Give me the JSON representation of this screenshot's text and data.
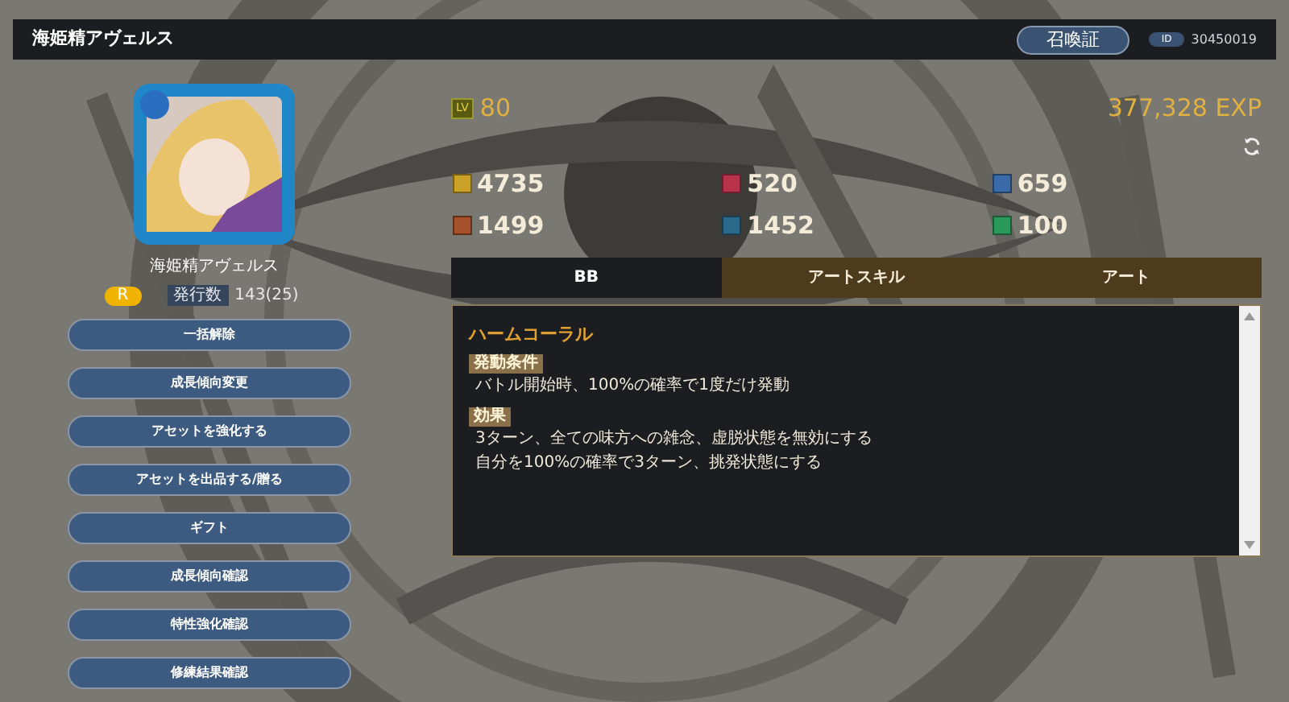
{
  "header": {
    "title": "海姫精アヴェルス",
    "card_button": "召喚証",
    "id_badge": "ID",
    "id_value": "30450019"
  },
  "unit": {
    "kind": "picture",
    "name": "海姫精アヴェルス",
    "rarity": "R",
    "issued_label": "発行数",
    "issued_value": "143(25)"
  },
  "actions": [
    "一括解除",
    "成長傾向変更",
    "アセットを強化する",
    "アセットを出品する/贈る",
    "ギフト",
    "成長傾向確認",
    "特性強化確認",
    "修練結果確認"
  ],
  "level": {
    "badge": "LV",
    "value": "80"
  },
  "exp": "377,328 EXP",
  "stats": [
    {
      "value": "4735",
      "color": "#c9a227"
    },
    {
      "value": "520",
      "color": "#b8324a"
    },
    {
      "value": "659",
      "color": "#3a6aa8"
    },
    {
      "value": "1499",
      "color": "#a4502a"
    },
    {
      "value": "1452",
      "color": "#2a6a8a"
    },
    {
      "value": "100",
      "color": "#2a9a5a"
    }
  ],
  "tabs": [
    {
      "label": "BB",
      "selected": true
    },
    {
      "label": "アートスキル",
      "selected": false
    },
    {
      "label": "アート",
      "selected": false
    }
  ],
  "skill": {
    "name": "ハームコーラル",
    "sections": [
      {
        "tag": "発動条件",
        "lines": [
          "バトル開始時、100%の確率で1度だけ発動"
        ]
      },
      {
        "tag": "効果",
        "lines": [
          "3ターン、全ての味方への雑念、虚脱状態を無効にする",
          "自分を100%の確率で3ターン、挑発状態にする"
        ]
      }
    ]
  }
}
